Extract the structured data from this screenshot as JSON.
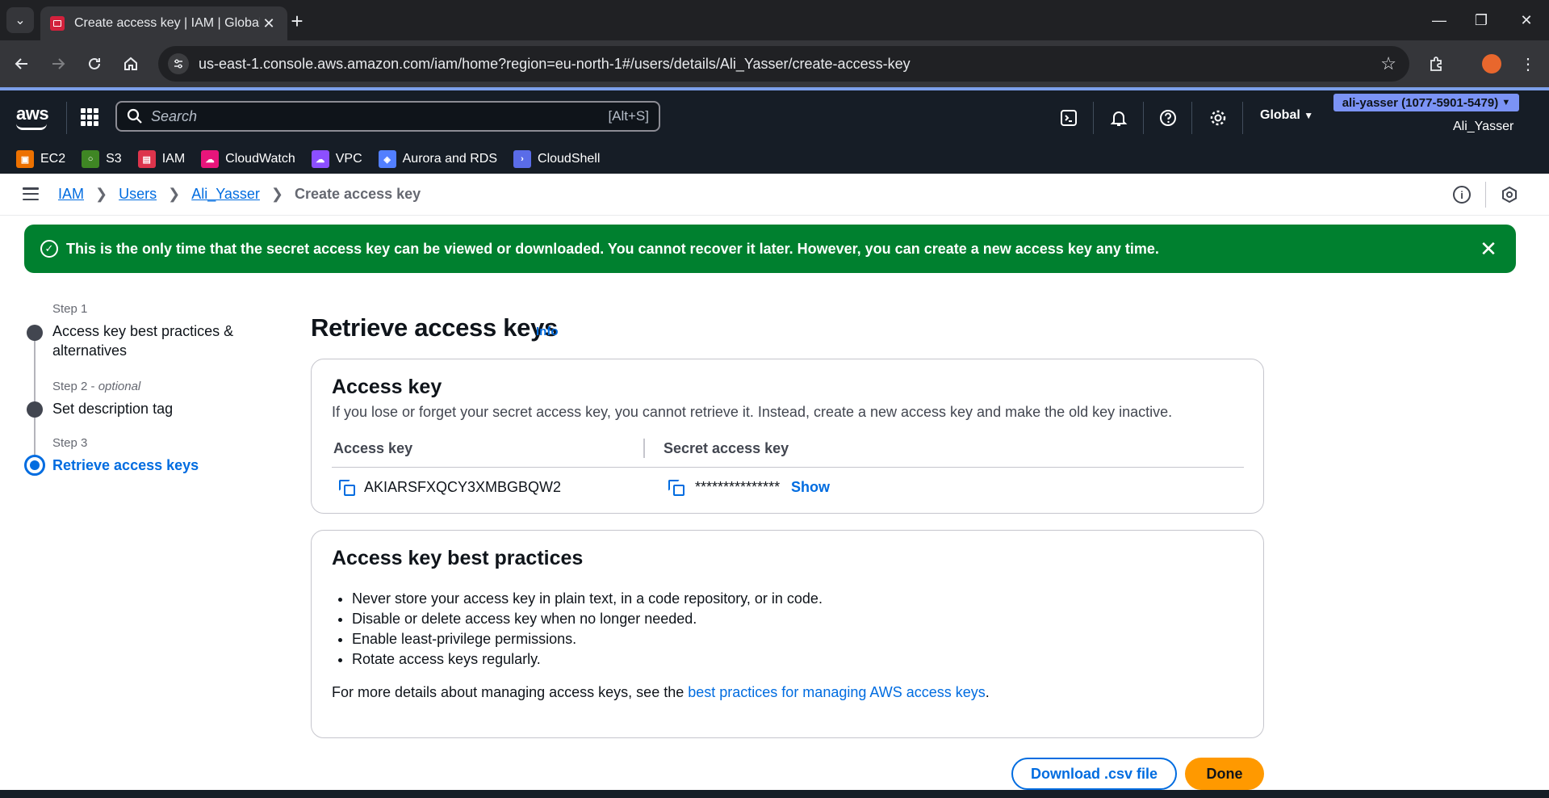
{
  "browser": {
    "tab_title": "Create access key | IAM | Global",
    "url": "us-east-1.console.aws.amazon.com/iam/home?region=eu-north-1#/users/details/Ali_Yasser/create-access-key"
  },
  "aws_nav": {
    "logo": "aws",
    "search_placeholder": "Search",
    "search_shortcut": "[Alt+S]",
    "region": "Global",
    "account_badge": "ali-yasser (1077-5901-5479)",
    "username": "Ali_Yasser",
    "favorites": [
      {
        "label": "EC2",
        "color": "#ed7100"
      },
      {
        "label": "S3",
        "color": "#3f8624"
      },
      {
        "label": "IAM",
        "color": "#dd344c"
      },
      {
        "label": "CloudWatch",
        "color": "#e7157b"
      },
      {
        "label": "VPC",
        "color": "#8c4fff"
      },
      {
        "label": "Aurora and RDS",
        "color": "#527fff"
      },
      {
        "label": "CloudShell",
        "color": "#5a6ce8"
      }
    ]
  },
  "breadcrumb": {
    "items": [
      "IAM",
      "Users",
      "Ali_Yasser"
    ],
    "current": "Create access key"
  },
  "flash": {
    "message": "This is the only time that the secret access key can be viewed or downloaded. You cannot recover it later. However, you can create a new access key any time."
  },
  "steps": [
    {
      "label": "Step 1",
      "optional": "",
      "title": "Access key best practices & alternatives"
    },
    {
      "label": "Step 2",
      "optional": "optional",
      "title": "Set description tag"
    },
    {
      "label": "Step 3",
      "optional": "",
      "title": "Retrieve access keys"
    }
  ],
  "main": {
    "title": "Retrieve access keys",
    "info": "Info",
    "access_key_card": {
      "heading": "Access key",
      "description": "If you lose or forget your secret access key, you cannot retrieve it. Instead, create a new access key and make the old key inactive.",
      "col_access_key": "Access key",
      "col_secret_key": "Secret access key",
      "access_key_value": "AKIARSFXQCY3XMBGBQW2",
      "secret_key_masked": "***************",
      "show_label": "Show"
    },
    "best_practices_card": {
      "heading": "Access key best practices",
      "items": [
        "Never store your access key in plain text, in a code repository, or in code.",
        "Disable or delete access key when no longer needed.",
        "Enable least-privilege permissions.",
        "Rotate access keys regularly."
      ],
      "more_prefix": "For more details about managing access keys, see the",
      "more_link": "best practices for managing AWS access keys",
      "more_suffix": "."
    },
    "download_button": "Download .csv file",
    "done_button": "Done"
  }
}
